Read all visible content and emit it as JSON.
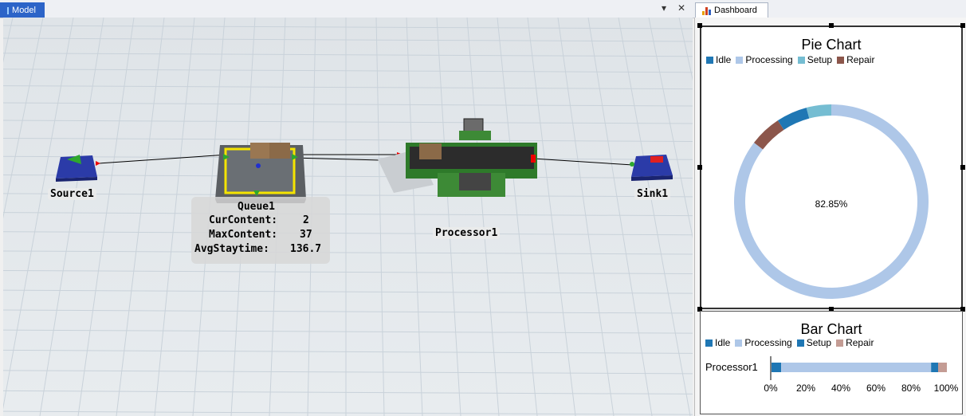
{
  "model_tab": {
    "label": "Model",
    "dropdown": "▾",
    "close": "✕"
  },
  "dashboard_tab": {
    "label": "Dashboard"
  },
  "objects": {
    "source": "Source1",
    "queue": "Queue1",
    "processor": "Processor1",
    "sink": "Sink1"
  },
  "queue_stats": {
    "cur_label": "CurContent:",
    "cur_value": "2",
    "max_label": "MaxContent:",
    "max_value": "37",
    "avg_label": "AvgStaytime:",
    "avg_value": "136.7"
  },
  "pie_chart": {
    "title": "Pie Chart",
    "legend": [
      {
        "name": "Idle",
        "color": "#1f77b4"
      },
      {
        "name": "Processing",
        "color": "#aec7e8"
      },
      {
        "name": "Setup",
        "color": "#75bdd2"
      },
      {
        "name": "Repair",
        "color": "#8c564b"
      }
    ],
    "center_label": "82.85%"
  },
  "bar_chart": {
    "title": "Bar Chart",
    "legend": [
      {
        "name": "Idle",
        "color": "#1f77b4"
      },
      {
        "name": "Processing",
        "color": "#aec7e8"
      },
      {
        "name": "Setup",
        "color": "#1f77b4"
      },
      {
        "name": "Repair",
        "color": "#c49c94"
      }
    ],
    "category": "Processor1",
    "ticks": [
      "0%",
      "20%",
      "40%",
      "60%",
      "80%",
      "100%"
    ]
  },
  "chart_data": [
    {
      "type": "pie",
      "title": "Pie Chart",
      "categories": [
        "Idle",
        "Processing",
        "Setup",
        "Repair"
      ],
      "values": [
        5.0,
        82.85,
        4.0,
        5.2
      ],
      "colors": [
        "#1f77b4",
        "#aec7e8",
        "#75bdd2",
        "#8c564b"
      ],
      "center_label": "82.85%"
    },
    {
      "type": "bar",
      "title": "Bar Chart",
      "categories": [
        "Processor1"
      ],
      "series": [
        {
          "name": "Idle",
          "values": [
            5.5
          ]
        },
        {
          "name": "Processing",
          "values": [
            85.5
          ]
        },
        {
          "name": "Setup",
          "values": [
            4.0
          ]
        },
        {
          "name": "Repair",
          "values": [
            5.0
          ]
        }
      ],
      "colors": [
        "#1f77b4",
        "#aec7e8",
        "#1f77b4",
        "#c49c94"
      ],
      "xlim": [
        0,
        100
      ],
      "stacked": true
    }
  ]
}
